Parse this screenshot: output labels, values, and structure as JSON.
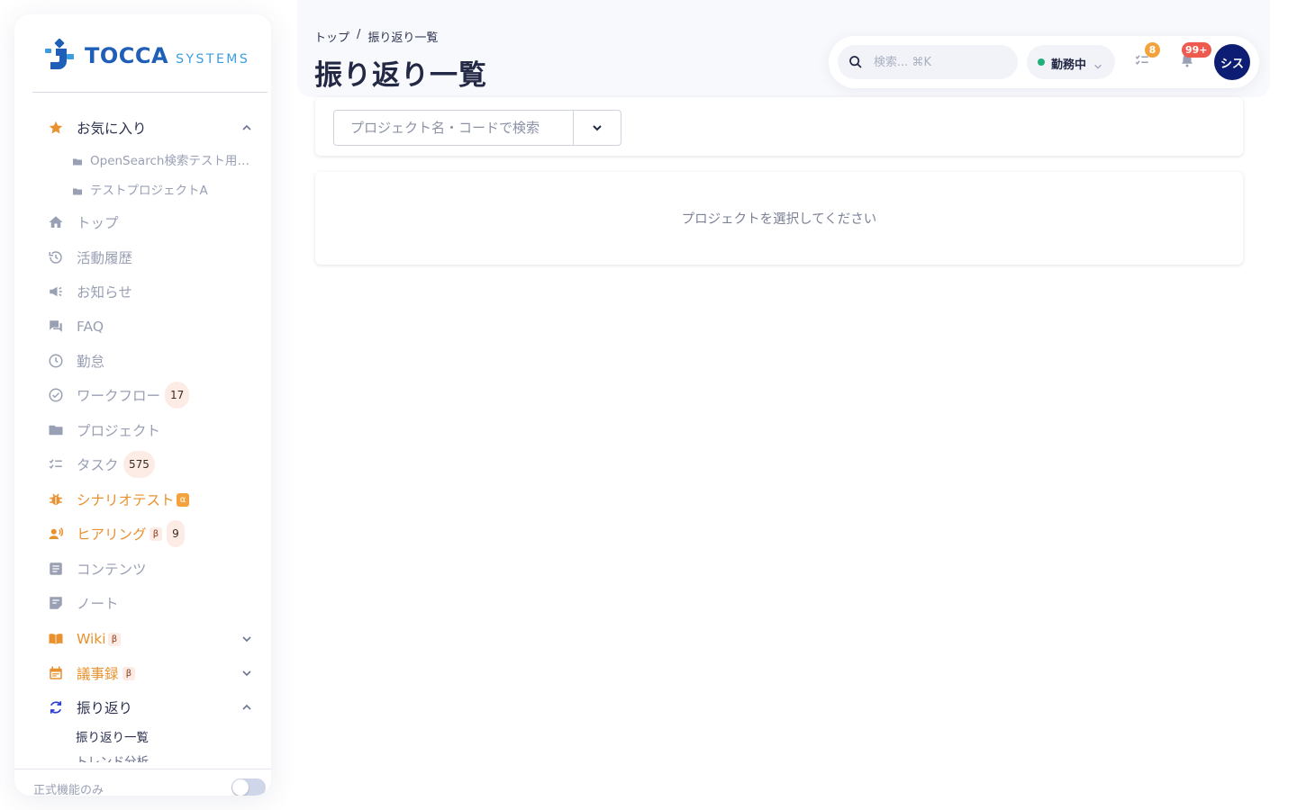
{
  "brand": {
    "name": "TOCCA",
    "sub": "SYSTEMS",
    "primary_color": "#1f5fb8",
    "accent_color": "#3b9de0"
  },
  "sidebar": {
    "favorites": {
      "label": "お気に入り",
      "items": [
        {
          "label": "OpenSearch検索テスト用プ..."
        },
        {
          "label": "テストプロジェクトA"
        }
      ]
    },
    "items": [
      {
        "label": "トップ",
        "icon": "home-icon"
      },
      {
        "label": "活動履歴",
        "icon": "history-icon"
      },
      {
        "label": "お知らせ",
        "icon": "megaphone-icon"
      },
      {
        "label": "FAQ",
        "icon": "forum-icon"
      },
      {
        "label": "勤怠",
        "icon": "clock-icon"
      },
      {
        "label": "ワークフロー",
        "icon": "check-circle-icon",
        "count": "17"
      },
      {
        "label": "プロジェクト",
        "icon": "folder-icon"
      },
      {
        "label": "タスク",
        "icon": "checklist-icon",
        "count": "575"
      },
      {
        "label": "シナリオテスト",
        "icon": "bug-icon",
        "tag": "α"
      },
      {
        "label": "ヒアリング",
        "icon": "voice-icon",
        "tag": "β",
        "count": "9"
      },
      {
        "label": "コンテンツ",
        "icon": "article-icon"
      },
      {
        "label": "ノート",
        "icon": "note-icon"
      },
      {
        "label": "Wiki",
        "icon": "book-icon",
        "tag": "β"
      },
      {
        "label": "議事録",
        "icon": "calendar-icon",
        "tag": "β"
      },
      {
        "label": "振り返り",
        "icon": "refresh-icon"
      }
    ],
    "retro_sub": [
      {
        "label": "振り返り一覧"
      },
      {
        "label": "トレンド分析"
      }
    ],
    "footer": {
      "label": "正式機能のみ",
      "toggle_on": false
    }
  },
  "header": {
    "breadcrumb": {
      "home": "トップ",
      "separator": "/",
      "current": "振り返り一覧"
    },
    "title": "振り返り一覧"
  },
  "toolbar": {
    "search_placeholder": "検索... ⌘K",
    "status_label": "勤務中",
    "tasks_badge": "8",
    "notifications_badge": "99+",
    "avatar_initials": "シス",
    "colors": {
      "online": "#1fb07a",
      "tasks_badge": "#f4a23c",
      "notifications_badge": "#ef5a4f",
      "avatar": "#0d1d73"
    }
  },
  "main": {
    "project_search_placeholder": "プロジェクト名・コードで検索",
    "empty_message": "プロジェクトを選択してください"
  }
}
